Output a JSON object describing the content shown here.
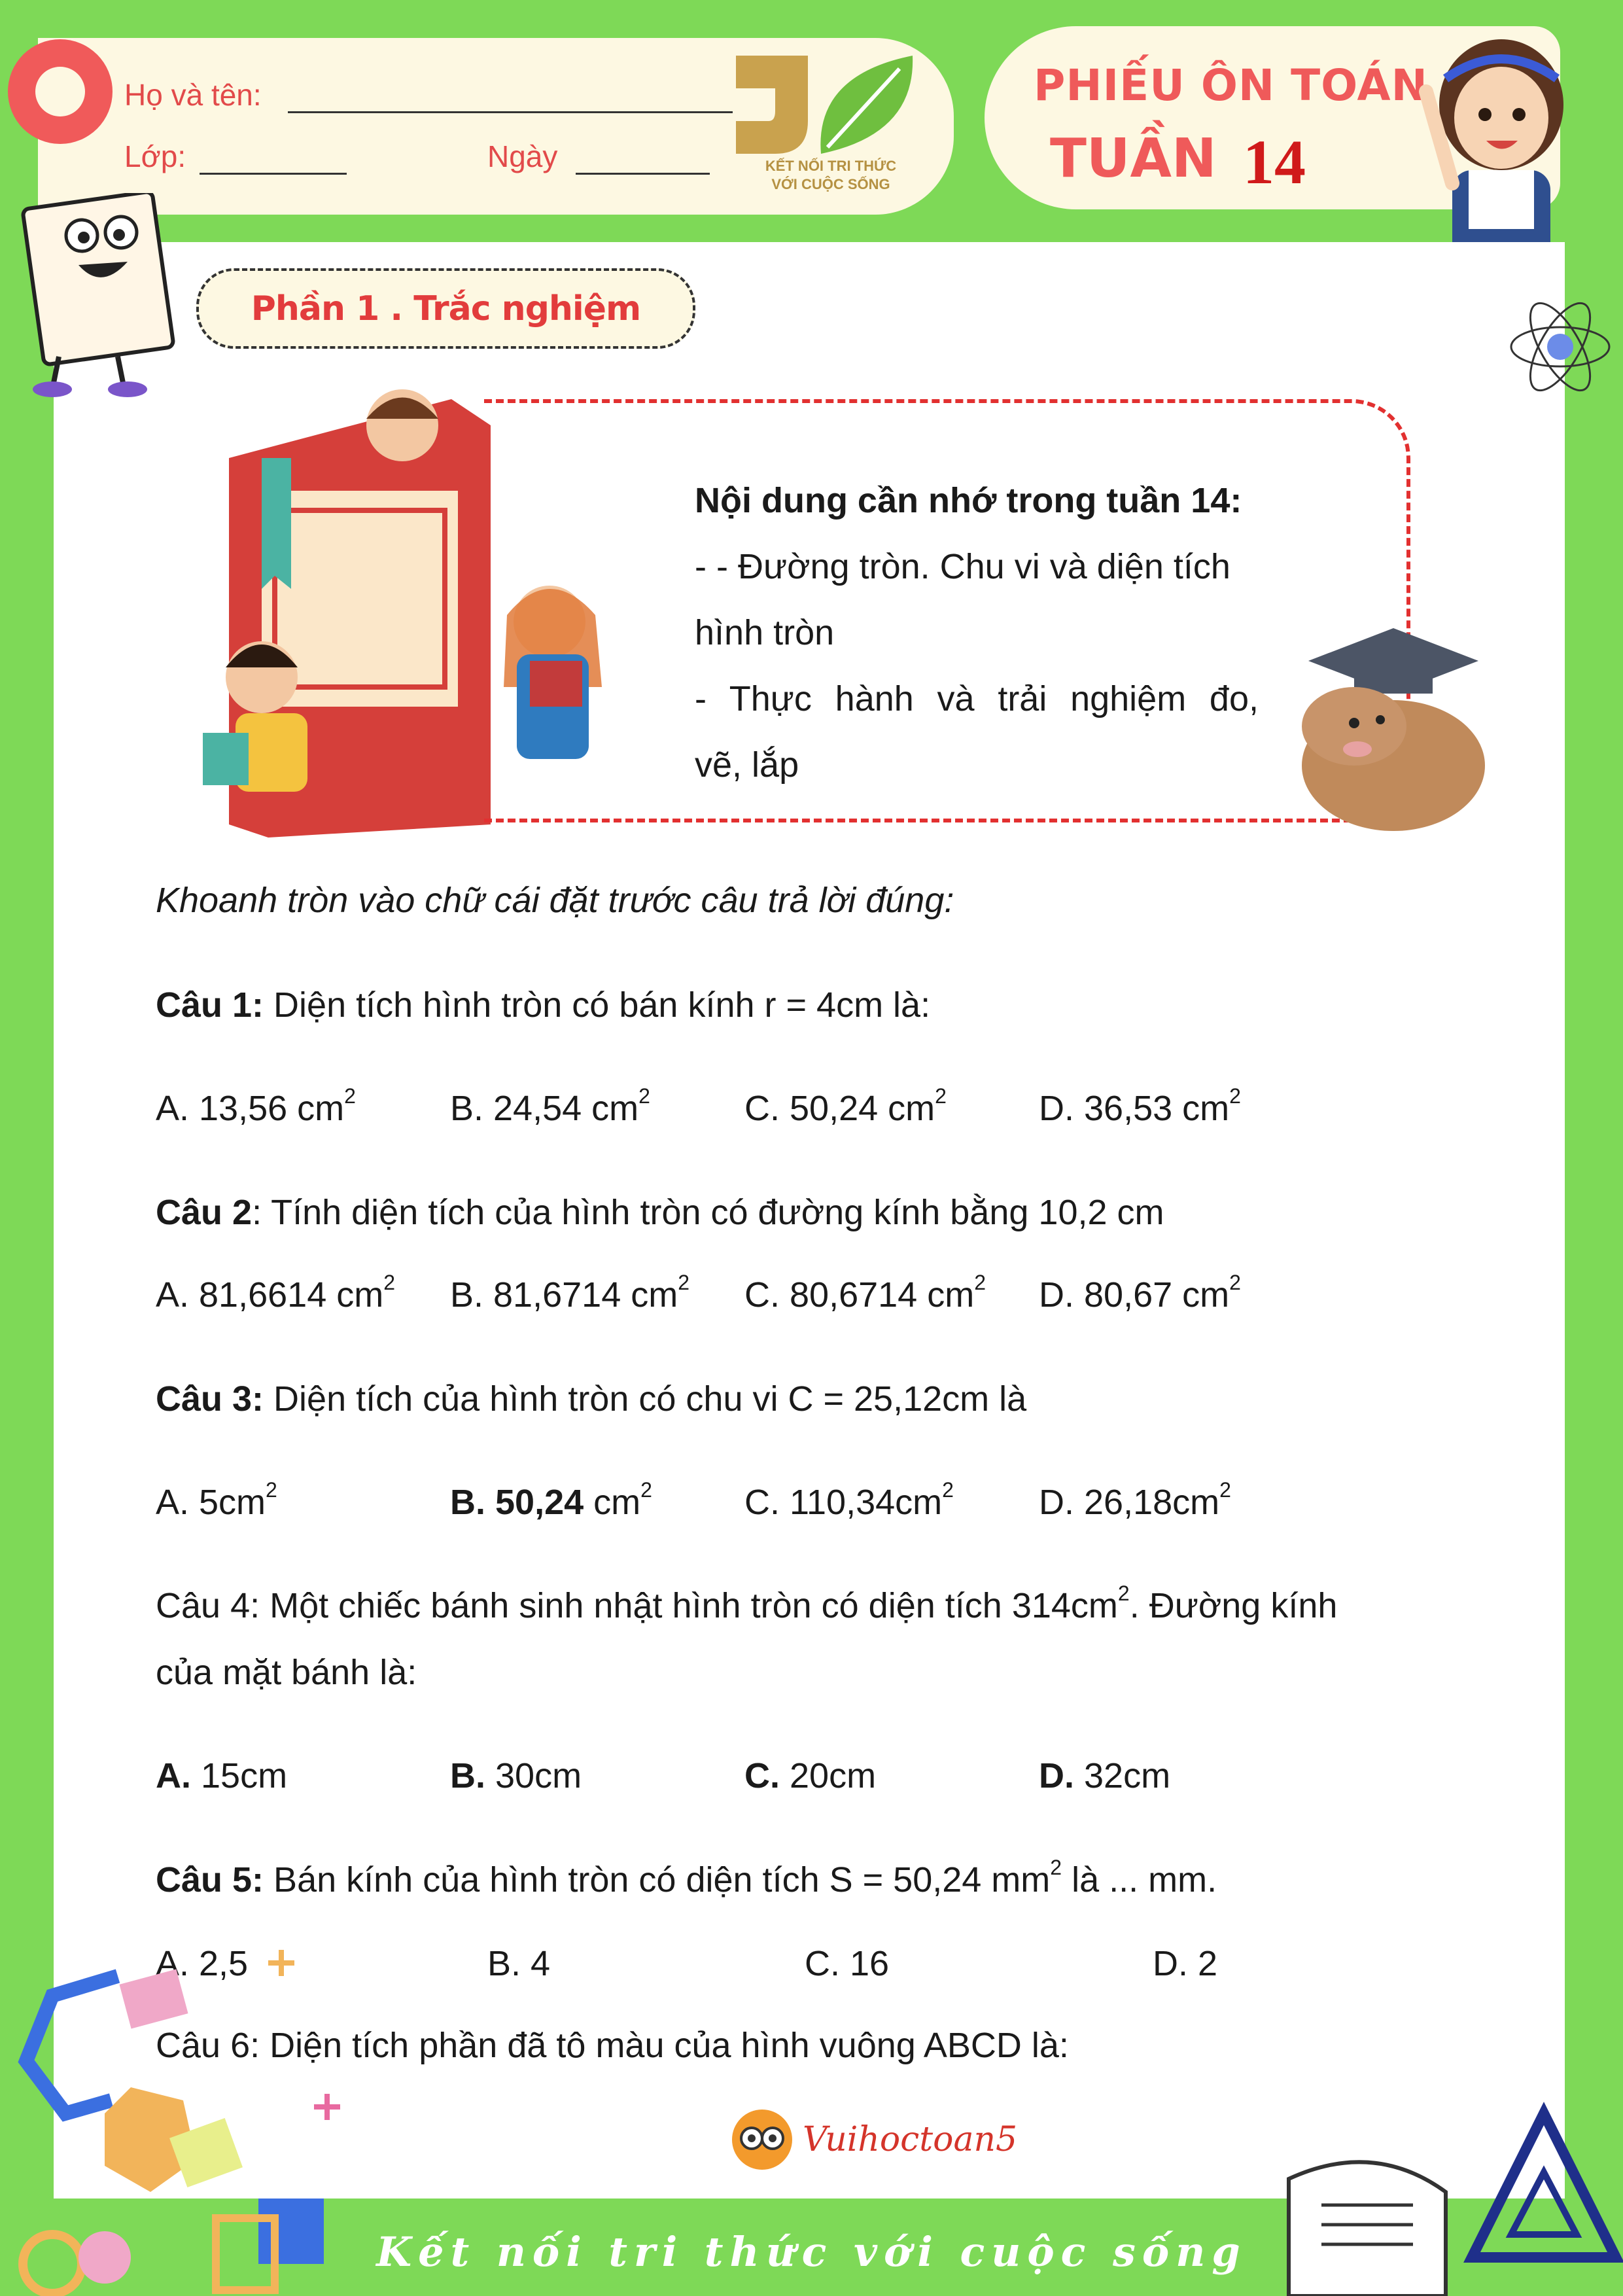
{
  "header": {
    "name_label": "Họ và tên:",
    "class_label": "Lớp:",
    "date_label": "Ngày",
    "logo_line1": "KẾT NỐI TRI THỨC",
    "logo_line2": "VỚI CUỘC SỐNG",
    "title_line1": "PHIẾU ÔN TOÁN",
    "title_line2": "TUẦN",
    "week_number": "14"
  },
  "section": {
    "title": "Phần 1 . Trắc nghiệm"
  },
  "notes": {
    "title": "Nội dung cần nhớ trong tuần 14:",
    "line1": "- - Đường tròn. Chu vi và diện tích",
    "line2": "hình tròn",
    "line3": "- Thực hành và trải nghiệm đo,",
    "line4": "vẽ, lắp"
  },
  "instruction": "Khoanh tròn vào chữ cái đặt trước câu trả lời đúng:",
  "questions": [
    {
      "label": "Câu 1:",
      "text": " Diện tích hình tròn có bán kính r = 4cm là:",
      "options": [
        {
          "text": "A. 13,56 cm",
          "sup": "2"
        },
        {
          "text": "B. 24,54 cm",
          "sup": "2"
        },
        {
          "text": "C. 50,24 cm",
          "sup": "2"
        },
        {
          "text": "D. 36,53 cm",
          "sup": "2"
        }
      ]
    },
    {
      "label": "Câu 2",
      "text": ": Tính diện tích của hình tròn có đường kính bằng 10,2 cm",
      "options": [
        {
          "text": "A. 81,6614 cm",
          "sup": "2"
        },
        {
          "text": "B. 81,6714 cm",
          "sup": "2"
        },
        {
          "text": "C. 80,6714 cm",
          "sup": "2"
        },
        {
          "text": "D. 80,67 cm",
          "sup": "2"
        }
      ]
    },
    {
      "label": "Câu 3:",
      "text": " Diện tích của hình tròn có chu vi C = 25,12cm là",
      "options": [
        {
          "text": "A. 5cm",
          "sup": "2"
        },
        {
          "bold": "B. 50,24",
          "text": " cm",
          "sup": "2"
        },
        {
          "text": "C. 110,34cm",
          "sup": "2"
        },
        {
          "text": "D. 26,18cm",
          "sup": "2"
        }
      ]
    },
    {
      "text_a": "Câu 4: Một chiếc bánh sinh nhật hình tròn có diện tích 314cm",
      "sup": "2",
      "text_b": ". Đường kính",
      "text_line2": "của mặt bánh là:",
      "options": [
        {
          "bold": "A.",
          "text": " 15cm"
        },
        {
          "bold": "B.",
          "text": " 30cm"
        },
        {
          "bold": "C.",
          "text": " 20cm"
        },
        {
          "bold": "D.",
          "text": " 32cm"
        }
      ]
    },
    {
      "label": "Câu 5:",
      "text_a": " Bán kính của hình tròn có diện tích S = 50,24 mm",
      "sup": "2",
      "text_b": " là ... mm.",
      "options": [
        {
          "text": "A. 2,5"
        },
        {
          "text": "B. 4"
        },
        {
          "text": "C. 16"
        },
        {
          "text": "D. 2"
        }
      ]
    },
    {
      "text": "Câu 6: Diện tích phần đã tô màu của hình vuông ABCD là:"
    }
  ],
  "brand": "Vuihoctoan5",
  "footer": "Kết nối tri thức với cuộc sống",
  "colors": {
    "background_green": "#7ed957",
    "accent_red": "#e23c3c",
    "cream": "#fdf8e2"
  }
}
